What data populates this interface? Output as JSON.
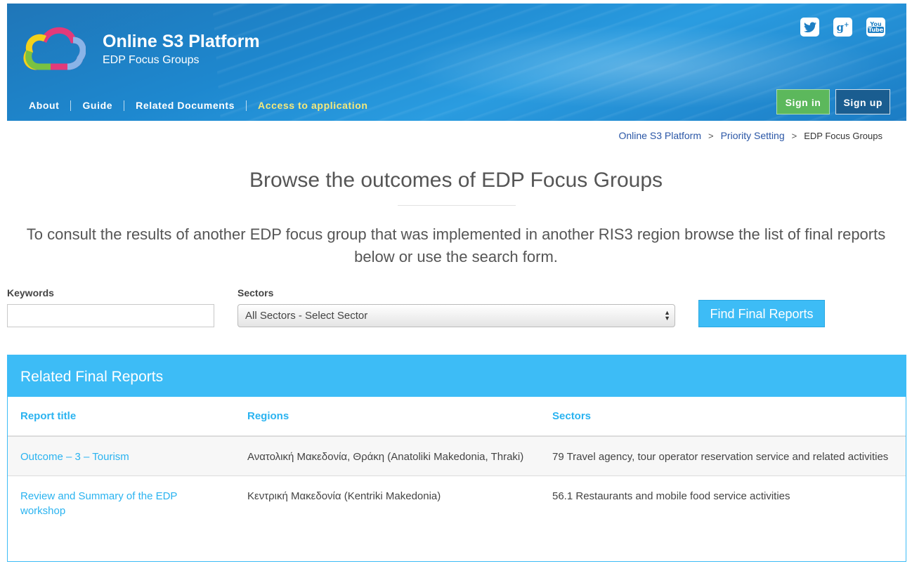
{
  "header": {
    "title": "Online S3 Platform",
    "subtitle": "EDP Focus Groups",
    "social": [
      {
        "name": "twitter-icon",
        "glyph": "t"
      },
      {
        "name": "google-plus-icon",
        "glyph": "g+"
      },
      {
        "name": "youtube-icon",
        "glyph": "You Tube"
      }
    ],
    "nav": [
      "About",
      "Guide",
      "Related Documents",
      "Access to application"
    ],
    "sign_in": "Sign in",
    "sign_up": "Sign up"
  },
  "breadcrumb": {
    "items": [
      "Online S3 Platform",
      "Priority Setting"
    ],
    "separator": ">",
    "current": "EDP Focus Groups"
  },
  "main": {
    "title": "Browse the outcomes of EDP Focus Groups",
    "intro": "To consult the results of another EDP focus group that was implemented in another RIS3 region browse the list of final reports below or use the search form."
  },
  "search": {
    "keywords_label": "Keywords",
    "keywords_value": "",
    "sectors_label": "Sectors",
    "sectors_selected": "All Sectors - Select Sector",
    "button": "Find Final Reports"
  },
  "reports": {
    "heading": "Related Final Reports",
    "columns": [
      "Report title",
      "Regions",
      "Sectors"
    ],
    "rows": [
      {
        "title": "Outcome – 3 – Tourism",
        "region": "Ανατολική Μακεδονία, Θράκη (Anatoliki Makedonia, Thraki)",
        "sector": "79 Travel agency, tour operator reservation service and related activities"
      },
      {
        "title": "Review and Summary of the EDP workshop",
        "region": "Κεντρική Μακεδονία (Kentriki Makedonia)",
        "sector": "56.1 Restaurants and mobile food service activities"
      }
    ]
  },
  "colors": {
    "header_blue": "#1e88cf",
    "accent_cyan": "#3dbcf6",
    "signin_green": "#5cb85c",
    "nav_highlight": "#f6e97a",
    "link_blue": "#2a56a6"
  }
}
